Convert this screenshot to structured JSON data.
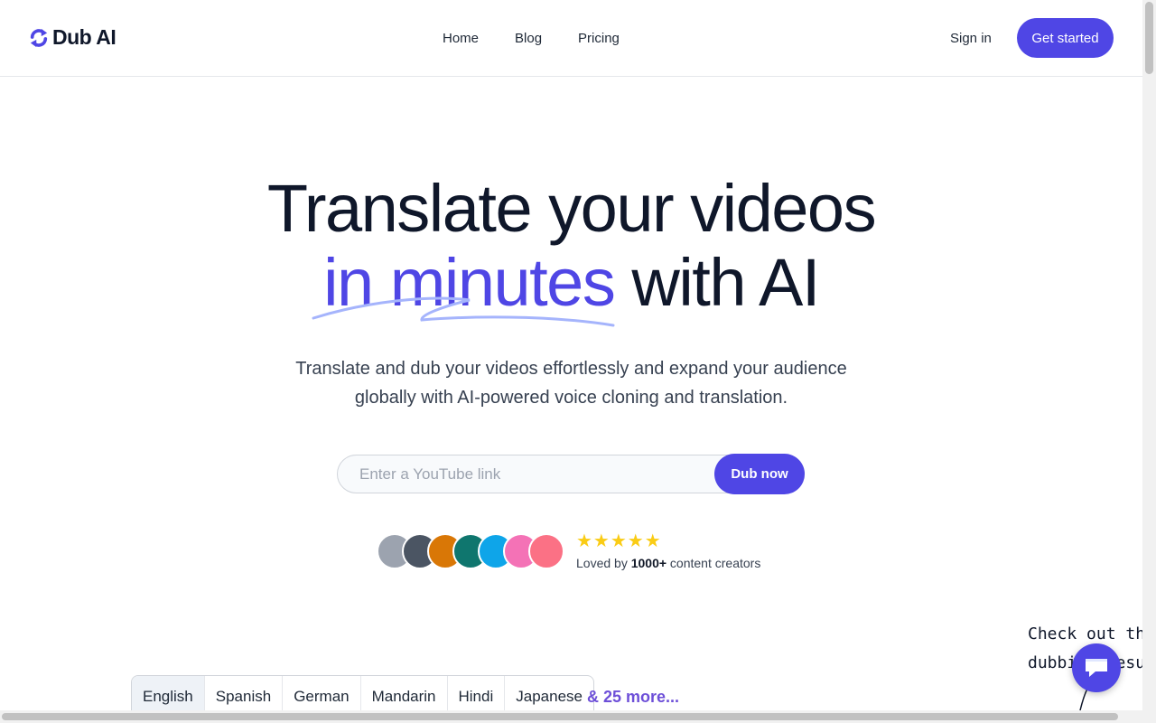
{
  "brand": {
    "name": "Dub AI",
    "icon": "refresh-arrows-icon",
    "accent_color": "#4f46e5"
  },
  "nav": {
    "items": [
      "Home",
      "Blog",
      "Pricing"
    ]
  },
  "header": {
    "sign_in": "Sign in",
    "get_started": "Get started"
  },
  "hero": {
    "title_line1": "Translate your videos",
    "title_accent": "in minutes",
    "title_rest": " with AI",
    "subtitle_line1": "Translate and dub your videos effortlessly and expand your audience",
    "subtitle_line2": "globally with AI-powered voice cloning and translation."
  },
  "search": {
    "placeholder": "Enter a YouTube link",
    "value": "",
    "button": "Dub now"
  },
  "social_proof": {
    "rating_stars": 5,
    "stars_text": "★★★★★",
    "loved_prefix": "Loved by ",
    "loved_count": "1000+",
    "loved_suffix": " content creators",
    "avatar_colors": [
      "#9ca3af",
      "#4b5563",
      "#d97706",
      "#0f766e",
      "#0ea5e9",
      "#f472b6",
      "#fb7185"
    ]
  },
  "languages": {
    "tabs": [
      "English",
      "Spanish",
      "German",
      "Mandarin",
      "Hindi",
      "Japanese"
    ],
    "active": "English",
    "more": "& 25 more..."
  },
  "callout": {
    "line1": "Check out the",
    "line2": "dubbing results"
  },
  "chat": {
    "icon": "chat-bubble-icon"
  }
}
